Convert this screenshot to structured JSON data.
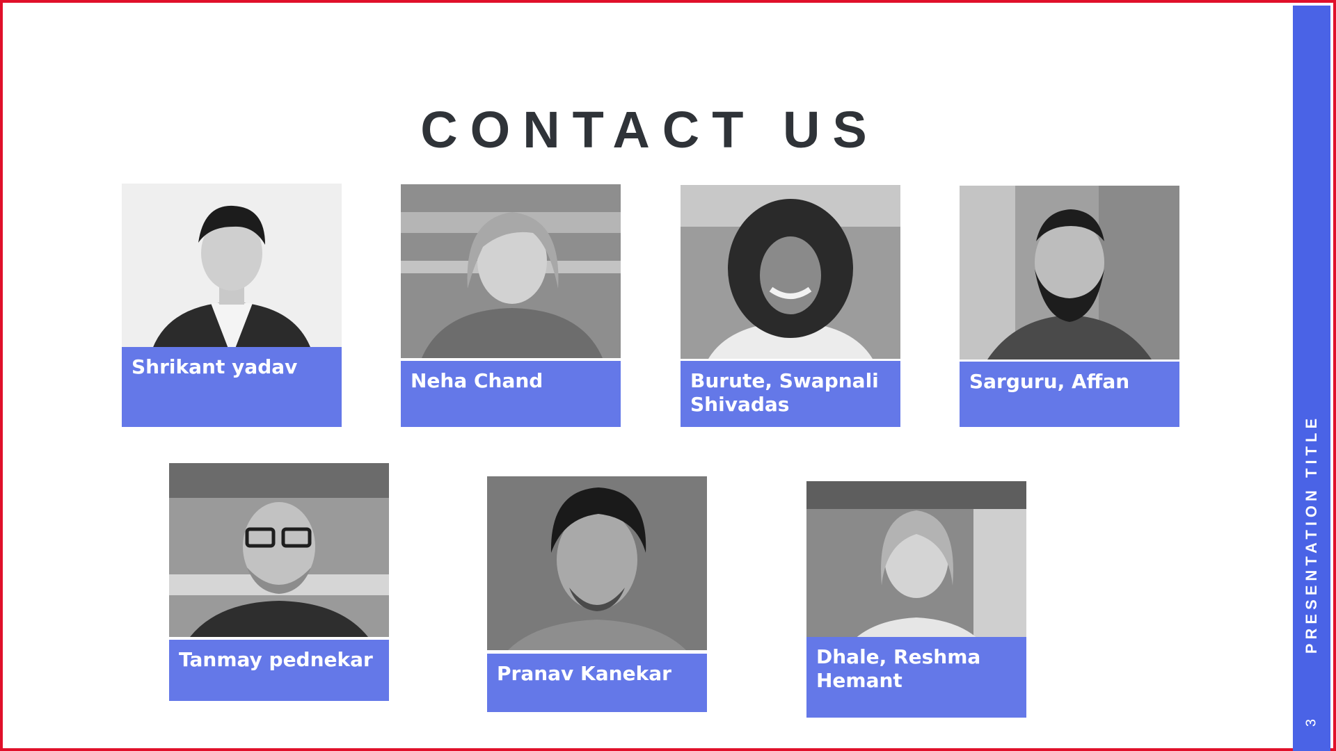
{
  "slide": {
    "title": "CONTACT US",
    "side_title": "PRESENTATION TITLE",
    "page_number": "3"
  },
  "colors": {
    "accent": "#4a63e6",
    "card_label": "#6478e8",
    "border": "#e0102a",
    "title": "#2f3338"
  },
  "contacts": [
    {
      "name": "Shrikant yadav"
    },
    {
      "name": "Neha Chand"
    },
    {
      "name": "Burute, Swapnali Shivadas"
    },
    {
      "name": "Sarguru, Affan"
    },
    {
      "name": "Tanmay pednekar"
    },
    {
      "name": "Pranav Kanekar"
    },
    {
      "name": "Dhale, Reshma Hemant"
    }
  ]
}
